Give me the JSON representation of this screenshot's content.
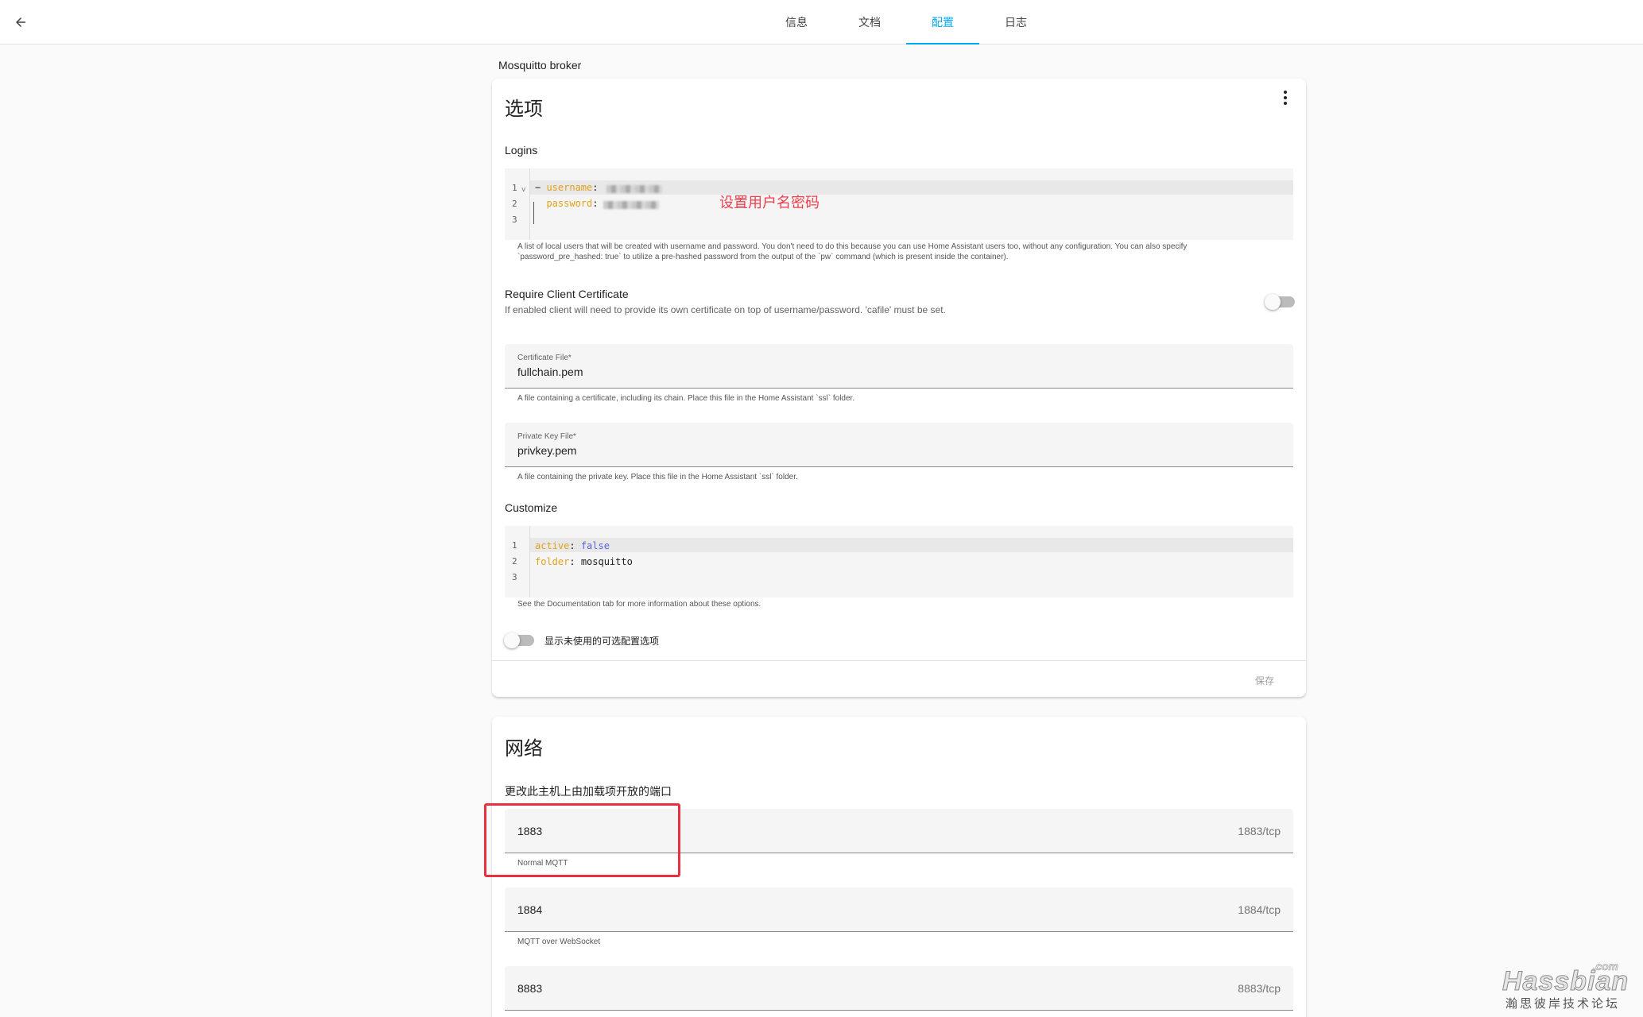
{
  "topbar": {
    "tabs": [
      {
        "label": "信息"
      },
      {
        "label": "文档"
      },
      {
        "label": "配置"
      },
      {
        "label": "日志"
      }
    ]
  },
  "addon_name": "Mosquitto broker",
  "options_card": {
    "title": "选项",
    "logins": {
      "label": "Logins",
      "line_numbers": [
        "1",
        "2",
        "3"
      ],
      "fold_marker": "v",
      "lines": [
        {
          "dash": "− ",
          "key": "username",
          "colon": ":"
        },
        {
          "dash": "  ",
          "key": "password",
          "colon": ":"
        }
      ],
      "helper_line1": "A list of local users that will be created with username and password. You don't need to do this because you can use Home Assistant users too, without any configuration. You can also specify",
      "helper_line2": "`password_pre_hashed: true` to utilize a pre-hashed password from the output of the `pw` command (which is present inside the container)."
    },
    "annotation": "设置用户名密码",
    "require_client_cert": {
      "title": "Require Client Certificate",
      "description": "If enabled client will need to provide its own certificate on top of username/password. 'cafile' must be set.",
      "enabled": false
    },
    "certfile": {
      "label": "Certificate File*",
      "value": "fullchain.pem",
      "helper": "A file containing a certificate, including its chain. Place this file in the Home Assistant `ssl` folder."
    },
    "keyfile": {
      "label": "Private Key File*",
      "value": "privkey.pem",
      "helper": "A file containing the private key. Place this file in the Home Assistant `ssl` folder."
    },
    "customize": {
      "label": "Customize",
      "line_numbers": [
        "1",
        "2",
        "3"
      ],
      "line1_key": "active",
      "line1_colon": ": ",
      "line1_value": "false",
      "line2_key": "folder",
      "line2_colon": ": ",
      "line2_value": "mosquitto",
      "helper": "See the Documentation tab for more information about these options."
    },
    "show_unused": {
      "label": "显示未使用的可选配置选项",
      "enabled": false
    },
    "save_label": "保存"
  },
  "network_card": {
    "title": "网络",
    "description": "更改此主机上由加载项开放的端口",
    "ports": [
      {
        "value": "1883",
        "suffix": "1883/tcp",
        "helper": "Normal MQTT"
      },
      {
        "value": "1884",
        "suffix": "1884/tcp",
        "helper": "MQTT over WebSocket"
      },
      {
        "value": "8883",
        "suffix": "8883/tcp",
        "helper": ""
      }
    ]
  },
  "watermark": {
    "brand": "Hassbian",
    "tld": ".com",
    "subtitle": "瀚思彼岸技术论坛"
  },
  "colors": {
    "accent": "#03a9f4",
    "annotation_red": "#ef3d4a",
    "yaml_key": "#e0a21b",
    "yaml_keyword": "#5a63d8"
  }
}
